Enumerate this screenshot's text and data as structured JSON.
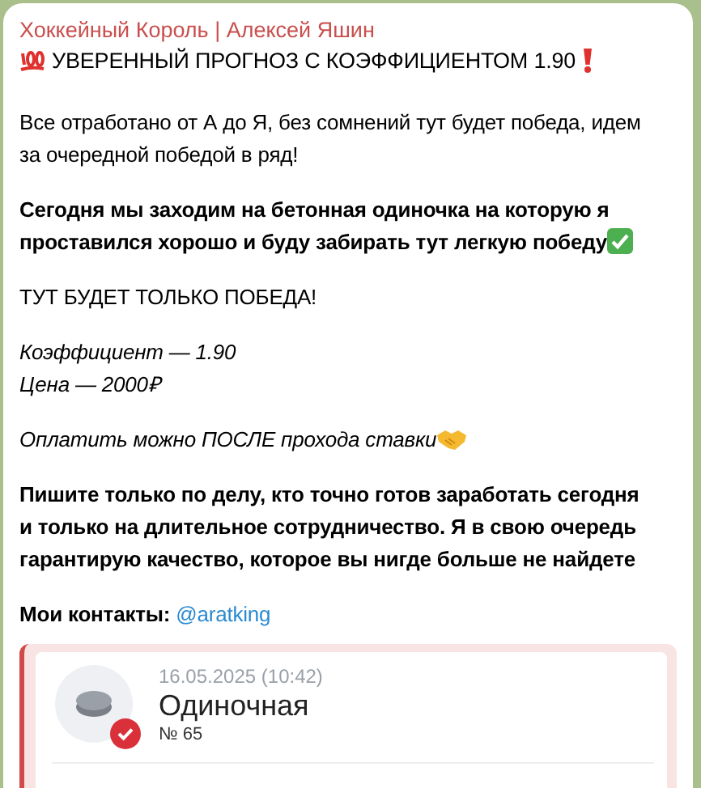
{
  "author": "Хоккейный Король | Алексей Яшин",
  "message": [
    {
      "kind": "title",
      "lines": [
        "УВЕРЕННЫЙ ПРОГНОЗ С КОЭФФИЦИЕНТОМ 1.90"
      ]
    },
    {
      "kind": "text",
      "lines": [
        "Все отработано от А до Я, без сомнений тут будет победа, идем",
        "за очередной победой в ряд!"
      ]
    },
    {
      "kind": "bold",
      "lines": [
        "Сегодня мы заходим на бетонная одиночка на которую я",
        "проставился хорошо и буду забирать тут легкую победу"
      ]
    },
    {
      "kind": "text",
      "lines": [
        "ТУТ БУДЕТ ТОЛЬКО ПОБЕДА!"
      ]
    },
    {
      "kind": "italic",
      "lines": [
        "Коэффициент — 1.90",
        "Цена — 2000₽"
      ]
    },
    {
      "kind": "italic",
      "lines": [
        "Оплатить можно ПОСЛЕ прохода ставки"
      ]
    },
    {
      "kind": "bold",
      "lines": [
        "Пишите только по делу, кто точно готов заработать сегодня",
        "и только на длительное сотрудничество. Я в свою очередь",
        "гарантирую качество, которое вы нигде больше не найдете"
      ]
    },
    {
      "kind": "contacts",
      "label": "Мои контакты:",
      "link": "@aratking"
    }
  ],
  "bet_card": {
    "date": "16.05.2025 (10:42)",
    "title": "Одиночная",
    "number": "№ 65",
    "settled": true
  }
}
